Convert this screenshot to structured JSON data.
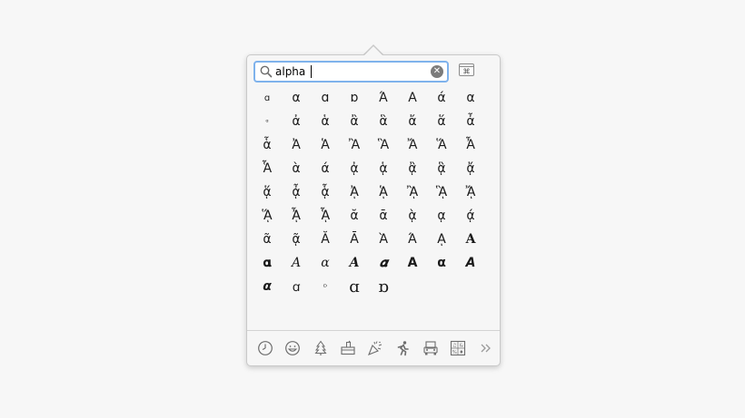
{
  "search": {
    "value": "alpha",
    "clear_label": "✕"
  },
  "glyph_rows": [
    [
      "ɑ",
      "α",
      "ɑ",
      "ɒ",
      "Ά",
      "Α",
      "ά",
      "α"
    ],
    [
      "ᵅ",
      "ἀ",
      "ἁ",
      "ἂ",
      "ἃ",
      "ἄ",
      "ἅ",
      "ἆ"
    ],
    [
      "ἇ",
      "Ἀ",
      "Ἁ",
      "Ἂ",
      "Ἃ",
      "Ἄ",
      "Ἅ",
      "Ἆ"
    ],
    [
      "Ἇ",
      "ὰ",
      "ά",
      "ᾀ",
      "ᾁ",
      "ᾂ",
      "ᾃ",
      "ᾄ"
    ],
    [
      "ᾅ",
      "ᾆ",
      "ᾇ",
      "ᾈ",
      "ᾉ",
      "ᾊ",
      "ᾋ",
      "ᾌ"
    ],
    [
      "ᾍ",
      "ᾎ",
      "ᾏ",
      "ᾰ",
      "ᾱ",
      "ᾲ",
      "ᾳ",
      "ᾴ"
    ],
    [
      "ᾶ",
      "ᾷ",
      "Ᾰ",
      "Ᾱ",
      "Ὰ",
      "Ά",
      "ᾼ",
      "𝚨"
    ],
    [
      "𝛂",
      "𝛢",
      "𝛼",
      "𝜜",
      "𝜶",
      "𝝖",
      "𝝰",
      "𝞐"
    ],
    [
      "𝞪",
      "ꭤ",
      "ᴰ",
      "ɑ",
      "ɒ"
    ]
  ],
  "category_icons": [
    "recent-clock-icon",
    "smiley-icon",
    "tree-icon",
    "food-cup-icon",
    "celebration-icon",
    "running-person-icon",
    "car-icon",
    "symbols-icon",
    "more-chevron-icon"
  ]
}
